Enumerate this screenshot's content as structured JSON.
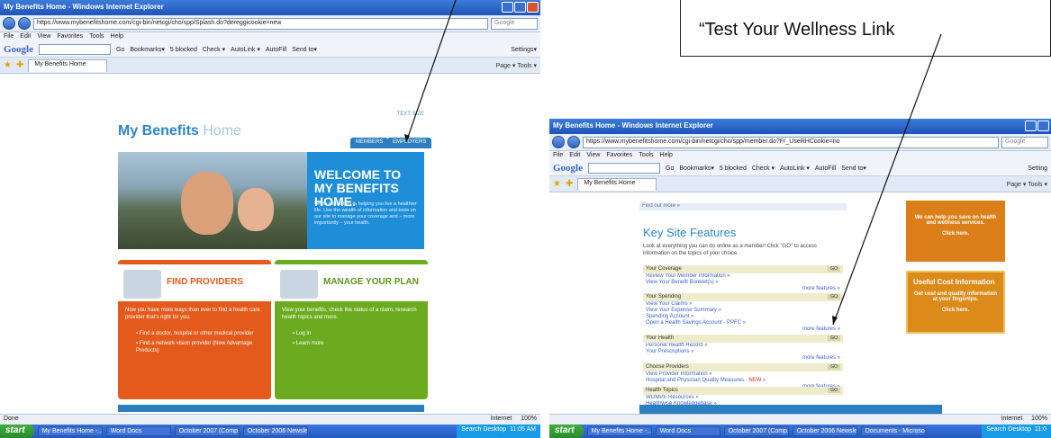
{
  "callout": {
    "text": "“Test Your Wellness Link"
  },
  "window1": {
    "title": "My Benefits Home - Windows Internet Explorer",
    "url": "https://www.mybenefitshome.com/cgi-bin/netcgi/cho/spp/Splash.do?dereggicookie=new",
    "search_placeholder": "Google",
    "menu": [
      "File",
      "Edit",
      "View",
      "Favorites",
      "Tools",
      "Help"
    ],
    "google_label": "Google",
    "google_tools": [
      "Go",
      "Bookmarks▾",
      "5 blocked",
      "Check ▾",
      "AutoLink ▾",
      "AutoFill",
      "Send to▾",
      "Settings▾"
    ],
    "tab": "My Benefits Home",
    "tab_tools": "Page ▾  Tools ▾",
    "page": {
      "brand_main": "My Benefits",
      "brand_sub": "Home",
      "text_size": "TEXT SIZE",
      "nav_members": "MEMBERS",
      "nav_employers": "EMPLOYERS",
      "hero_title": "WELCOME TO MY BENEFITS HOME.",
      "hero_text": "We're committed to helping you live a healthier life. Use the wealth of information and tools on our site to manage your coverage and – more importantly – your health.",
      "find_title": "FIND PROVIDERS",
      "find_text": "Now you have more ways than ever to find a health care provider that's right for you.",
      "find_link1": "Find a doctor, hospital or other medical provider",
      "find_link2": "Find a network vision provider (New Advantage Products)",
      "manage_title": "MANAGE YOUR PLAN",
      "manage_text": "View your benefits, check the status of a claim, research health topics and more.",
      "manage_link1": "Log in",
      "manage_link2": "Learn more"
    },
    "status_left": "Done",
    "status_zone": "Internet",
    "status_zoom": "100%",
    "taskbar": {
      "start": "start",
      "tasks": [
        "My Benefits Home -...",
        "Word Docs",
        "October 2007 (Comp...",
        "October 2006 Newsle..."
      ],
      "search": "Search Desktop",
      "clock": "11:05 AM"
    }
  },
  "window2": {
    "title": "My Benefits Home - Windows Internet Explorer",
    "url": "https://www.mybenefitshome.com/cgi-bin/netcgi/cho/spp/member.do?Fr_UseRHCookie=no",
    "search_placeholder": "Google",
    "menu": [
      "File",
      "Edit",
      "View",
      "Favorites",
      "Tools",
      "Help"
    ],
    "google_label": "Google",
    "google_tools": [
      "Go",
      "Bookmarks▾",
      "5 blocked",
      "Check ▾",
      "AutoLink ▾",
      "AutoFill",
      "Send to▾",
      "Setting"
    ],
    "tab": "My Benefits Home",
    "tab_tools": "Page ▾  Tools ▾",
    "page": {
      "find_link": "Find out more »",
      "key_title": "Key Site Features",
      "key_intro": "Look at everything you can do online as a member! Click \"GO\" to access information on the topics of your choice.",
      "go": "GO",
      "more": "more features »",
      "sections": [
        {
          "title": "Your Coverage",
          "links": [
            "Review Your Member Information »",
            "View Your Benefit Booklet(s) »"
          ]
        },
        {
          "title": "Your Spending",
          "links": [
            "View Your Claims »",
            "View Your Expense Summary »",
            "Spending Account »",
            "Open a Health Savings Account - PPFC »"
          ]
        },
        {
          "title": "Your Health",
          "links": [
            "Personal Health Record »",
            "Your Prescriptions »"
          ]
        },
        {
          "title": "Choose Providers",
          "links": [
            "View Provider Information »",
            "Hospital and Physician Quality Measures - "
          ],
          "new_badge": "NEW",
          "new_suffix": " »"
        },
        {
          "title": "Health Topics",
          "links": [
            "WOMPE Resources »",
            "Healthwise Knowledgebase »"
          ]
        }
      ],
      "side1": "We can help you save on health and wellness services.",
      "side1_cta": "Click here.",
      "side2_head": "Useful Cost Information",
      "side2": "Get cost and quality information at your fingertips.",
      "side2_cta": "Click here."
    },
    "status_zone": "Internet",
    "status_zoom": "100%",
    "taskbar": {
      "start": "start",
      "tasks": [
        "My Benefits Home -...",
        "Word Docs",
        "October 2007 (Comp...",
        "October 2006 Newsle...",
        "Documents - Microsoft..."
      ],
      "search": "Search Desktop",
      "clock": "11:0"
    }
  }
}
